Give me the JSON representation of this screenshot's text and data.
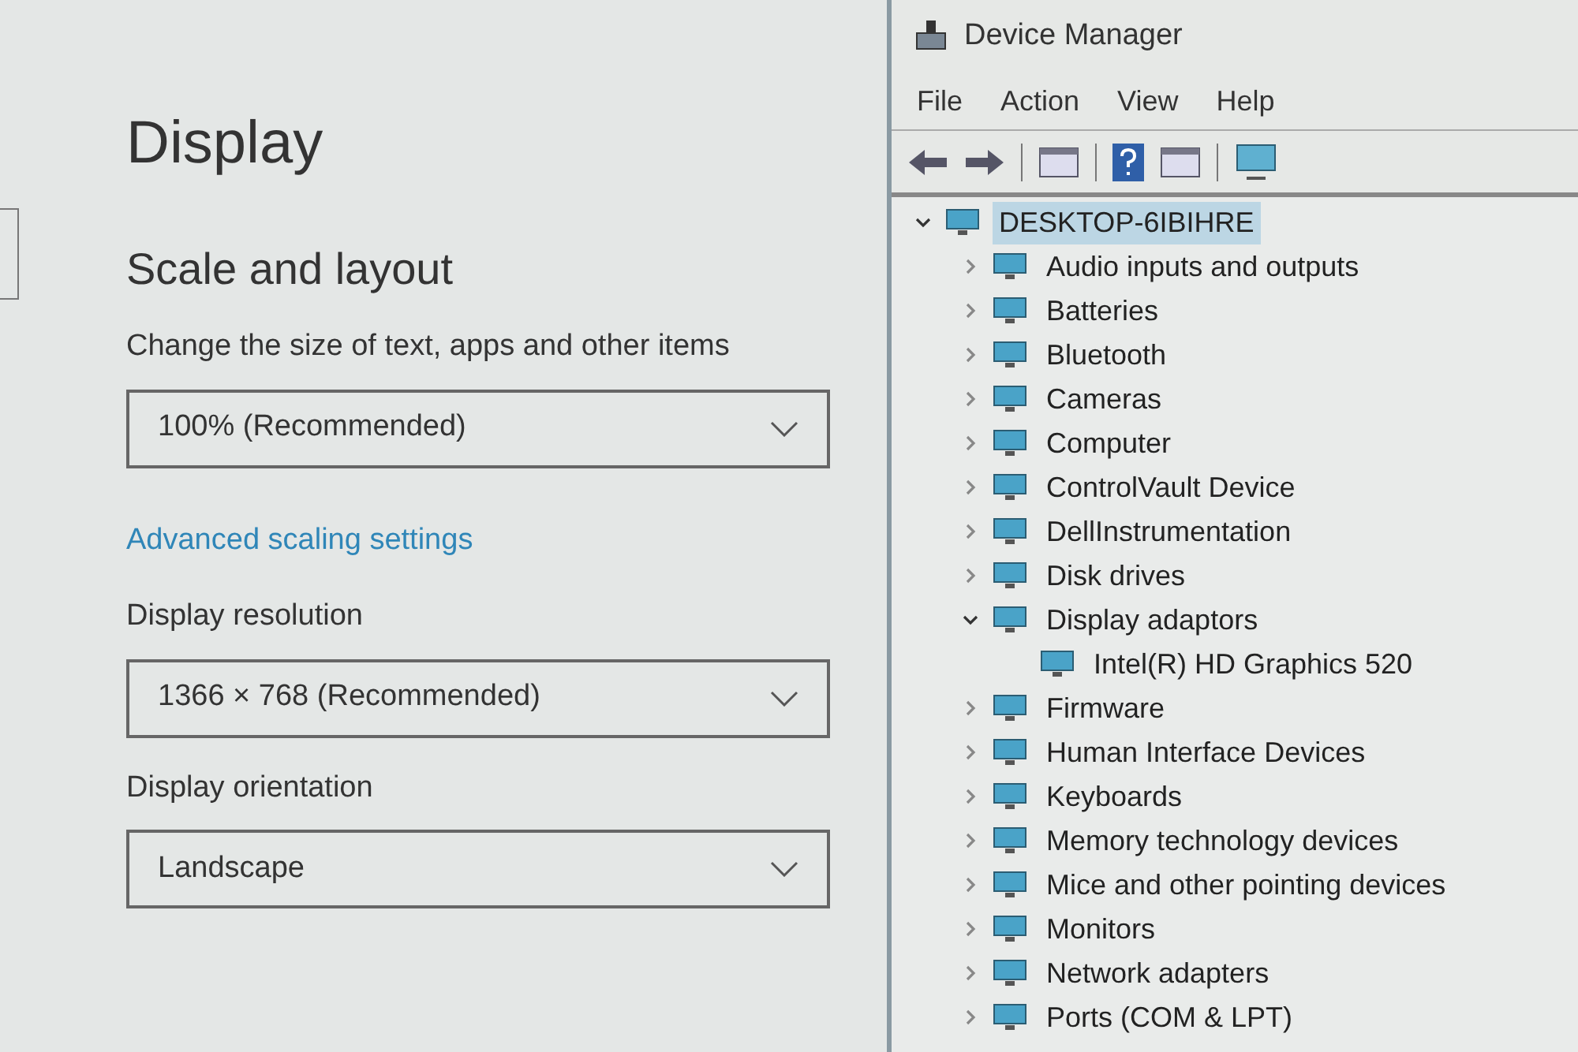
{
  "settings": {
    "title": "Display",
    "section": "Scale and layout",
    "fields": [
      {
        "label": "Change the size of text, apps and other items",
        "value": "100% (Recommended)"
      },
      {
        "link": "Advanced scaling settings"
      },
      {
        "label": "Display resolution",
        "value": "1366 × 768 (Recommended)"
      },
      {
        "label": "Display orientation",
        "value": "Landscape"
      }
    ]
  },
  "device_manager": {
    "window": {
      "title": "Device Manager"
    },
    "menu": [
      "File",
      "Action",
      "View",
      "Help"
    ],
    "tree": {
      "label": "DESKTOP-6IBIHRE",
      "expanded": true,
      "selected": true,
      "children": [
        {
          "label": "Audio inputs and outputs",
          "expanded": false
        },
        {
          "label": "Batteries",
          "expanded": false
        },
        {
          "label": "Bluetooth",
          "expanded": false
        },
        {
          "label": "Cameras",
          "expanded": false
        },
        {
          "label": "Computer",
          "expanded": false
        },
        {
          "label": "ControlVault Device",
          "expanded": false
        },
        {
          "label": "DellInstrumentation",
          "expanded": false
        },
        {
          "label": "Disk drives",
          "expanded": false
        },
        {
          "label": "Display adaptors",
          "expanded": true,
          "children": [
            {
              "label": "Intel(R) HD Graphics 520"
            }
          ]
        },
        {
          "label": "Firmware",
          "expanded": false
        },
        {
          "label": "Human Interface Devices",
          "expanded": false
        },
        {
          "label": "Keyboards",
          "expanded": false
        },
        {
          "label": "Memory technology devices",
          "expanded": false
        },
        {
          "label": "Mice and other pointing devices",
          "expanded": false
        },
        {
          "label": "Monitors",
          "expanded": false
        },
        {
          "label": "Network adapters",
          "expanded": false
        },
        {
          "label": "Ports (COM & LPT)",
          "expanded": false
        }
      ]
    }
  }
}
